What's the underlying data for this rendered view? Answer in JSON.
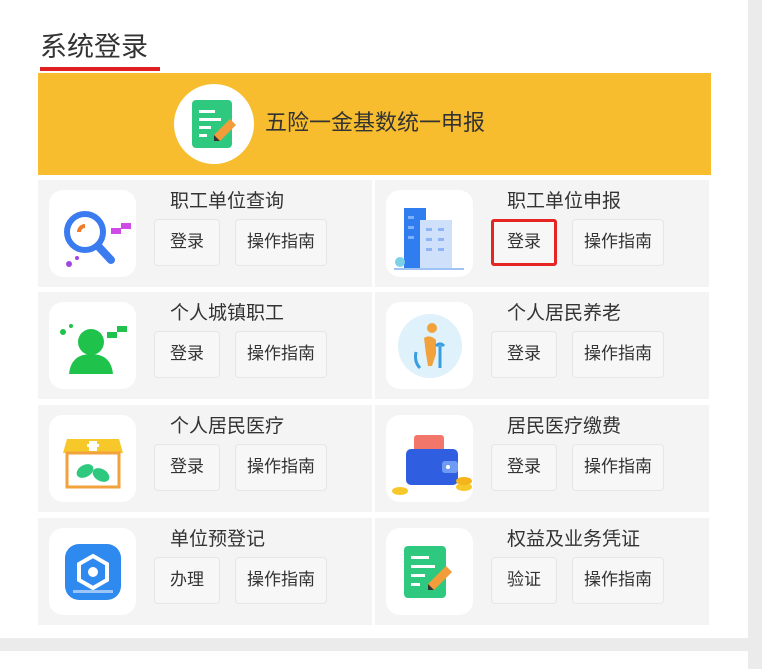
{
  "page": {
    "title": "系统登录"
  },
  "banner": {
    "label": "五险一金基数统一申报",
    "icon": "form-edit-icon"
  },
  "colors": {
    "banner_bg": "#f7bd2e",
    "accent_underline": "#e02020",
    "highlight_border": "#e52424"
  },
  "cards": [
    {
      "title": "职工单位查询",
      "action": "登录",
      "guide": "操作指南",
      "icon": "search-magnifier-icon"
    },
    {
      "title": "职工单位申报",
      "action": "登录",
      "guide": "操作指南",
      "icon": "office-building-icon",
      "action_highlighted": true
    },
    {
      "title": "个人城镇职工",
      "action": "登录",
      "guide": "操作指南",
      "icon": "person-chat-icon"
    },
    {
      "title": "个人居民养老",
      "action": "登录",
      "guide": "操作指南",
      "icon": "elderly-cane-icon"
    },
    {
      "title": "个人居民医疗",
      "action": "登录",
      "guide": "操作指南",
      "icon": "pharmacy-store-icon"
    },
    {
      "title": "居民医疗缴费",
      "action": "登录",
      "guide": "操作指南",
      "icon": "wallet-coins-icon"
    },
    {
      "title": "单位预登记",
      "action": "办理",
      "guide": "操作指南",
      "icon": "gear-badge-icon"
    },
    {
      "title": "权益及业务凭证",
      "action": "验证",
      "guide": "操作指南",
      "icon": "document-edit-icon"
    }
  ]
}
